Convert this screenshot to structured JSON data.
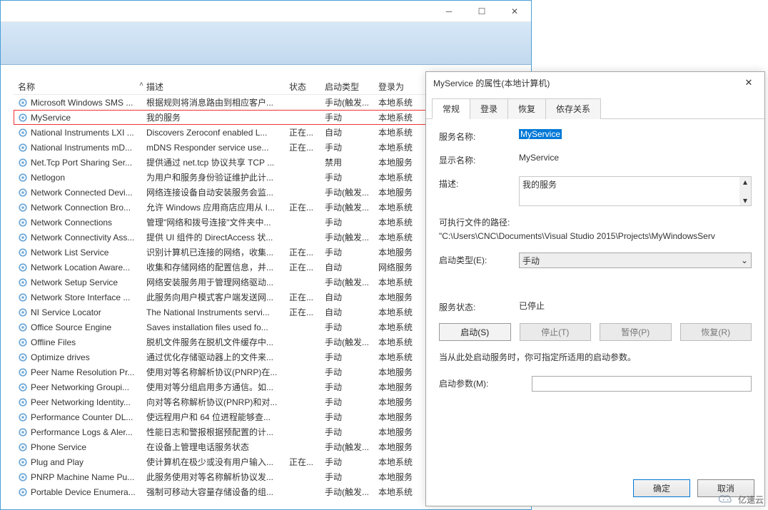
{
  "window": {
    "columns": {
      "name": "名称",
      "desc": "描述",
      "status": "状态",
      "start": "启动类型",
      "logon": "登录为"
    }
  },
  "services": [
    {
      "name": "Microsoft Windows SMS ...",
      "desc": "根据规则将消息路由到相应客户...",
      "status": "",
      "start": "手动(触发...",
      "logon": "本地系统"
    },
    {
      "name": "MyService",
      "desc": "我的服务",
      "status": "",
      "start": "手动",
      "logon": "本地系统",
      "selected": true
    },
    {
      "name": "National Instruments LXI ...",
      "desc": "Discovers Zeroconf enabled L...",
      "status": "正在...",
      "start": "自动",
      "logon": "本地系统"
    },
    {
      "name": "National Instruments mD...",
      "desc": "mDNS Responder service use...",
      "status": "正在...",
      "start": "手动",
      "logon": "本地系统"
    },
    {
      "name": "Net.Tcp Port Sharing Ser...",
      "desc": "提供通过 net.tcp 协议共享 TCP ...",
      "status": "",
      "start": "禁用",
      "logon": "本地服务"
    },
    {
      "name": "Netlogon",
      "desc": "为用户和服务身份验证维护此计...",
      "status": "",
      "start": "手动",
      "logon": "本地系统"
    },
    {
      "name": "Network Connected Devi...",
      "desc": "网络连接设备自动安装服务会监...",
      "status": "",
      "start": "手动(触发...",
      "logon": "本地服务"
    },
    {
      "name": "Network Connection Bro...",
      "desc": "允许 Windows 应用商店应用从 I...",
      "status": "正在...",
      "start": "手动(触发...",
      "logon": "本地系统"
    },
    {
      "name": "Network Connections",
      "desc": "管理\"网络和拨号连接\"文件夹中...",
      "status": "",
      "start": "手动",
      "logon": "本地系统"
    },
    {
      "name": "Network Connectivity Ass...",
      "desc": "提供 UI 组件的 DirectAccess 状...",
      "status": "",
      "start": "手动(触发...",
      "logon": "本地系统"
    },
    {
      "name": "Network List Service",
      "desc": "识别计算机已连接的网络，收集...",
      "status": "正在...",
      "start": "手动",
      "logon": "本地服务"
    },
    {
      "name": "Network Location Aware...",
      "desc": "收集和存储网络的配置信息，并...",
      "status": "正在...",
      "start": "自动",
      "logon": "网络服务"
    },
    {
      "name": "Network Setup Service",
      "desc": "网络安装服务用于管理网络驱动...",
      "status": "",
      "start": "手动(触发...",
      "logon": "本地系统"
    },
    {
      "name": "Network Store Interface ...",
      "desc": "此服务向用户模式客户端发送网...",
      "status": "正在...",
      "start": "自动",
      "logon": "本地服务"
    },
    {
      "name": "NI Service Locator",
      "desc": "The National Instruments servi...",
      "status": "正在...",
      "start": "自动",
      "logon": "本地系统"
    },
    {
      "name": "Office  Source Engine",
      "desc": "Saves installation files used fo...",
      "status": "",
      "start": "手动",
      "logon": "本地系统"
    },
    {
      "name": "Offline Files",
      "desc": "脱机文件服务在脱机文件缓存中...",
      "status": "",
      "start": "手动(触发...",
      "logon": "本地系统"
    },
    {
      "name": "Optimize drives",
      "desc": "通过优化存储驱动器上的文件来...",
      "status": "",
      "start": "手动",
      "logon": "本地系统"
    },
    {
      "name": "Peer Name Resolution Pr...",
      "desc": "使用对等名称解析协议(PNRP)在...",
      "status": "",
      "start": "手动",
      "logon": "本地服务"
    },
    {
      "name": "Peer Networking Groupi...",
      "desc": "使用对等分组启用多方通信。如...",
      "status": "",
      "start": "手动",
      "logon": "本地服务"
    },
    {
      "name": "Peer Networking Identity...",
      "desc": "向对等名称解析协议(PNRP)和对...",
      "status": "",
      "start": "手动",
      "logon": "本地服务"
    },
    {
      "name": "Performance Counter DL...",
      "desc": "使远程用户和 64 位进程能够查...",
      "status": "",
      "start": "手动",
      "logon": "本地服务"
    },
    {
      "name": "Performance Logs & Aler...",
      "desc": "性能日志和警报根据预配置的计...",
      "status": "",
      "start": "手动",
      "logon": "本地服务"
    },
    {
      "name": "Phone Service",
      "desc": "在设备上管理电话服务状态",
      "status": "",
      "start": "手动(触发...",
      "logon": "本地服务"
    },
    {
      "name": "Plug and Play",
      "desc": "使计算机在极少或没有用户输入...",
      "status": "正在...",
      "start": "手动",
      "logon": "本地系统"
    },
    {
      "name": "PNRP Machine Name Pu...",
      "desc": "此服务使用对等名称解析协议发...",
      "status": "",
      "start": "手动",
      "logon": "本地服务"
    },
    {
      "name": "Portable Device Enumera...",
      "desc": "强制可移动大容量存储设备的组...",
      "status": "",
      "start": "手动(触发...",
      "logon": "本地系统"
    }
  ],
  "dialog": {
    "title": "MyService 的属性(本地计算机)",
    "tabs": [
      "常规",
      "登录",
      "恢复",
      "依存关系"
    ],
    "labels": {
      "serviceName": "服务名称:",
      "displayName": "显示名称:",
      "description": "描述:",
      "exePath": "可执行文件的路径:",
      "startType": "启动类型(E):",
      "status": "服务状态:",
      "startParams": "启动参数(M):"
    },
    "values": {
      "serviceName": "MyService",
      "displayName": "MyService",
      "description": "我的服务",
      "exePath": "\"C:\\Users\\CNC\\Documents\\Visual Studio 2015\\Projects\\MyWindowsServ",
      "startType": "手动",
      "status": "已停止"
    },
    "hint": "当从此处启动服务时，你可指定所适用的启动参数。",
    "buttons": {
      "start": "启动(S)",
      "stop": "停止(T)",
      "pause": "暂停(P)",
      "resume": "恢复(R)",
      "ok": "确定",
      "cancel": "取消"
    }
  },
  "watermark": "亿速云"
}
